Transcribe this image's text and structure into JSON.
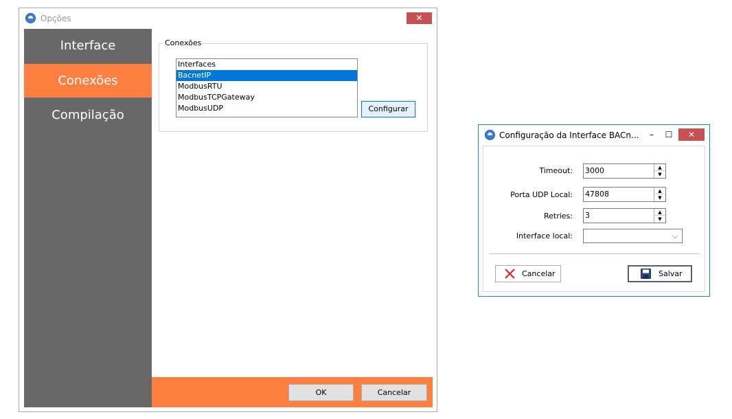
{
  "options_window": {
    "title": "Opções",
    "close_label": "✕",
    "sidebar": {
      "items": [
        {
          "label": "Interface",
          "active": false
        },
        {
          "label": "Conexões",
          "active": true
        },
        {
          "label": "Compilação",
          "active": false
        }
      ]
    },
    "connections": {
      "group_label": "Conexões",
      "list_items": [
        "Interfaces",
        "BacnetIP",
        "ModbusRTU",
        "ModbusTCPGateway",
        "ModbusUDP"
      ],
      "selected_item": "BacnetIP",
      "configure_label": "Configurar"
    },
    "footer": {
      "ok_label": "OK",
      "cancel_label": "Cancelar"
    }
  },
  "bacnet_dialog": {
    "title": "Configuração da Interface BACn...",
    "minimize_label": "–",
    "maximize_label": "☐",
    "close_label": "✕",
    "fields": {
      "timeout": {
        "label": "Timeout:",
        "value": "3000"
      },
      "udp_port": {
        "label": "Porta UDP Local:",
        "value": "47808"
      },
      "retries": {
        "label": "Retries:",
        "value": "3"
      },
      "interface_local": {
        "label": "Interface local:",
        "value": ""
      }
    },
    "cancel_label": "Cancelar",
    "save_label": "Salvar"
  },
  "colors": {
    "sidebar_bg": "#686868",
    "accent_orange": "#ff7f41",
    "selection_blue": "#0078d7",
    "close_red": "#c75050"
  },
  "icons": {
    "app": "app-logo-icon",
    "cancel": "x-icon",
    "save": "floppy-disk-icon",
    "spin_up": "triangle-up-icon",
    "spin_down": "triangle-down-icon",
    "combo": "chevron-down-icon"
  }
}
